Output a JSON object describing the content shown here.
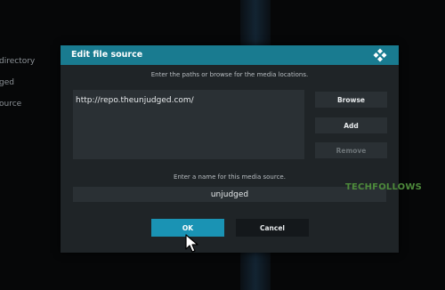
{
  "background_menu": {
    "items": [
      "directory",
      "ged",
      "ource"
    ]
  },
  "dialog": {
    "title": "Edit file source",
    "paths_instruction": "Enter the paths or browse for the media locations.",
    "paths": [
      "http://repo.theunjudged.com/"
    ],
    "buttons": {
      "browse": "Browse",
      "add": "Add",
      "remove": "Remove"
    },
    "name_instruction": "Enter a name for this media source.",
    "name_value": "unjudged",
    "ok": "OK",
    "cancel": "Cancel"
  },
  "watermark": "TECHFOLLOWS",
  "colors": {
    "header": "#197b90",
    "ok_button": "#1a93b4",
    "dialog_bg": "#1f2427",
    "watermark": "#4d8a3b"
  },
  "icons": {
    "logo": "kodi-logo-icon",
    "pointer": "mouse-cursor-icon"
  }
}
